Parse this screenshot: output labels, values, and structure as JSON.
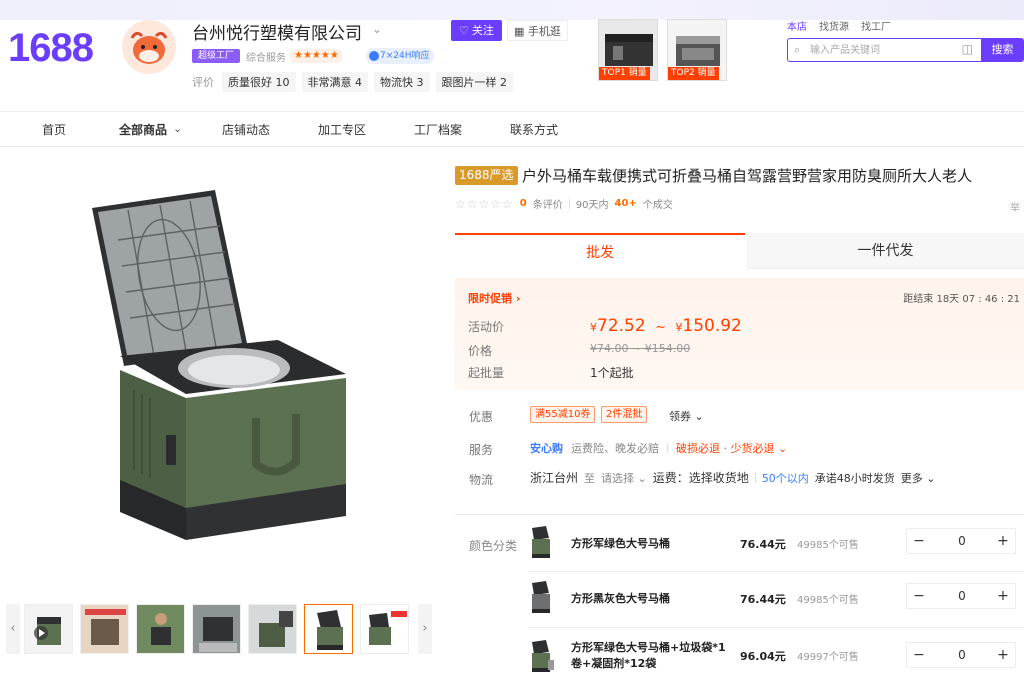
{
  "header": {
    "logo": "1688",
    "shop_name": "台州悦行塑模有限公司",
    "shop_caret": "⌄",
    "factory_badge": "超级工厂",
    "service_label": "综合服务",
    "service_stars": "★★★★★",
    "badge_7x24": "7×24H响应",
    "rating_label": "评价",
    "rating_tags": [
      "质量很好 10",
      "非常满意 4",
      "物流快 3",
      "跟图片一样 2"
    ],
    "follow_label": "关注",
    "mobile_label": "手机逛",
    "top_items": [
      {
        "label": "TOP1 销量"
      },
      {
        "label": "TOP2 销量"
      }
    ],
    "search_tabs": [
      "本店",
      "找货源",
      "找工厂"
    ],
    "search_placeholder": "输入产品关键词",
    "search_button": "搜索"
  },
  "nav": {
    "items": [
      "首页",
      "全部商品",
      "店铺动态",
      "加工专区",
      "工厂档案",
      "联系方式"
    ]
  },
  "product": {
    "tag": "1688严选",
    "title": "户外马桶车载便携式可折叠马桶自驾露营野营家用防臭厕所大人老人",
    "title_tail": "举",
    "review_stars": "☆☆☆☆☆",
    "review_count": "0",
    "review_suffix": "条评价",
    "sales_prefix": "90天内",
    "sales_count": "40+",
    "sales_suffix": "个成交",
    "tabs": [
      "批发",
      "一件代发"
    ]
  },
  "promo": {
    "tag": "限时促销 ›",
    "countdown": "距结束  18天 07 : 46 : 21",
    "activity_label": "活动价",
    "price_label": "价格",
    "moq_label": "起批量",
    "price_low": "72.52",
    "price_high": "150.92",
    "currency": "¥",
    "tilde": "~",
    "orig_range": "¥74.00  ~  ¥154.00",
    "moq": "1个起批"
  },
  "offers": {
    "discount_label": "优惠",
    "coupons": [
      "满55减10券",
      "2件混批"
    ],
    "coupon_more": "领券 ⌄",
    "service_label": "服务",
    "services": {
      "primary": "安心购",
      "extras": "运费险、晚发必赔",
      "damage": "破损必退 · 少货必退 ⌄"
    },
    "logistics_label": "物流",
    "logistics": {
      "origin": "浙江台州",
      "to": "至",
      "choose": "请选择 ⌄",
      "freight": "运费：选择收货地",
      "delivery": "50个以内",
      "promise": "承诺48小时发货",
      "more": "更多 ⌄"
    }
  },
  "sku": {
    "label": "颜色分类",
    "items": [
      {
        "name": "方形军绿色大号马桶",
        "price": "76.44元",
        "stock": "49985个可售",
        "qty": "0"
      },
      {
        "name": "方形黑灰色大号马桶",
        "price": "76.44元",
        "stock": "49985个可售",
        "qty": "0"
      },
      {
        "name": "方形军绿色大号马桶+垃圾袋*1卷+凝固剂*12袋",
        "price": "96.04元",
        "stock": "49997个可售",
        "qty": "0"
      }
    ]
  },
  "gallery": {
    "prev_icon": "‹",
    "next_icon": "›",
    "thumbs_count": 7,
    "active_thumb": 5
  },
  "colors": {
    "brand": "#6a3dff",
    "accent": "#ff4000",
    "green_body": "#5b7152",
    "dark": "#2b2d2f"
  }
}
